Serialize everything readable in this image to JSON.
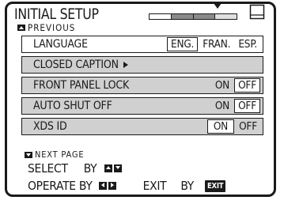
{
  "header": {
    "title": "INITIAL SETUP",
    "previous_label": "PREVIOUS",
    "previous_icon": "triangle-up-icon",
    "progress": {
      "segments_total": 4,
      "segments_done": 1
    },
    "tv_icon": "tv-icon"
  },
  "menu": {
    "language": {
      "label": "LANGUAGE",
      "options": [
        "ENG.",
        "FRAN.",
        "ESP."
      ],
      "selected": "ENG."
    },
    "closed_caption": {
      "label": "CLOSED CAPTION"
    },
    "front_panel_lock": {
      "label": "FRONT PANEL LOCK",
      "on": "ON",
      "off": "OFF",
      "selected": "OFF"
    },
    "auto_shut_off": {
      "label": "AUTO SHUT OFF",
      "on": "ON",
      "off": "OFF",
      "selected": "OFF"
    },
    "xds_id": {
      "label": "XDS ID",
      "on": "ON",
      "off": "OFF",
      "selected": "ON"
    }
  },
  "footer": {
    "next_label": "NEXT  PAGE",
    "select_label": "SELECT",
    "select_by": "BY",
    "operate_label": "OPERATE BY",
    "exit_label": "EXIT",
    "exit_by": "BY",
    "exit_key": "EXIT"
  },
  "colors": {
    "ink": "#1a1a1a",
    "row_shade": "#d0d0d0",
    "background": "#ffffff"
  }
}
